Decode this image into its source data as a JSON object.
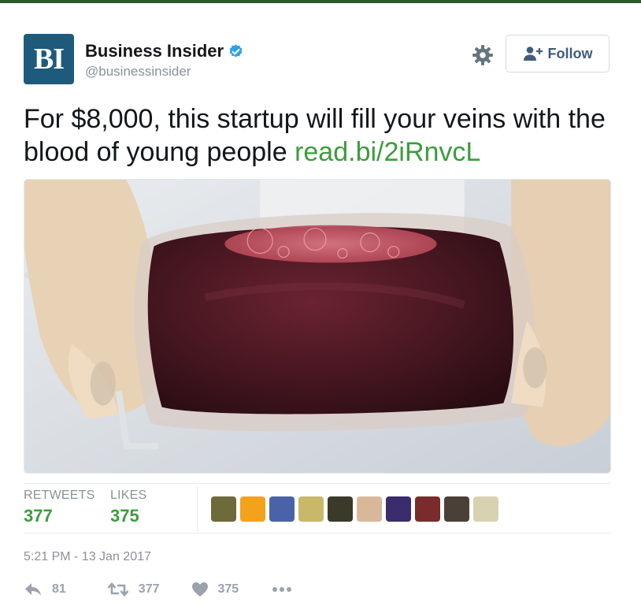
{
  "colors": {
    "accent_green": "#3d9c3d",
    "follow_blue": "#3f5c7c",
    "verified_blue": "#2ba3ec",
    "avatar_bg": "#1e5a7c",
    "muted_gray": "#8a9199"
  },
  "author": {
    "avatar_text": "BI",
    "name": "Business Insider",
    "handle": "@businessinsider",
    "verified_icon": "verified-badge-icon"
  },
  "header": {
    "settings_icon": "gear-icon",
    "follow_label": "Follow",
    "follow_icon": "add-user-icon"
  },
  "tweet": {
    "text": "For $8,000, this startup will fill your veins with the blood of young people ",
    "link": "read.bi/2iRnvcL",
    "photo_description": "Gloved hands holding a bag of blood"
  },
  "stats": {
    "retweets_label": "RETWEETS",
    "retweets_count": "377",
    "likes_label": "LIKES",
    "likes_count": "375",
    "liker_avatar_colors": [
      "#6f6a3a",
      "#f3a21c",
      "#4a62a8",
      "#c9b86a",
      "#3a3a28",
      "#d9b89a",
      "#3b2c6b",
      "#7a2b2b",
      "#4a4038",
      "#d9d2b0"
    ]
  },
  "timestamp": "5:21 PM - 13 Jan 2017",
  "actions": {
    "reply_count": "81",
    "retweet_count": "377",
    "like_count": "375",
    "more_icon": "more-icon"
  }
}
